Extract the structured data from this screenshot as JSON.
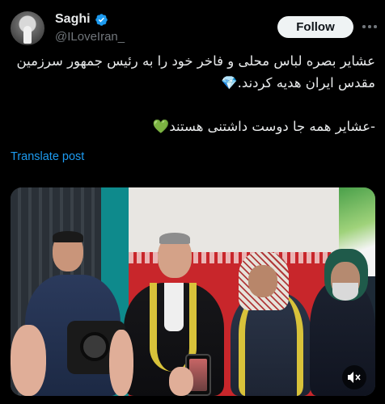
{
  "author": {
    "name": "Saghi",
    "handle": "@ILoveIran_",
    "verified_icon": "verified-badge-icon"
  },
  "actions": {
    "follow_label": "Follow",
    "more_icon": "more-options-icon"
  },
  "tweet": {
    "line1": "عشایر بصره لباس محلی و فاخر خود را به رئیس جمهور سرزمین",
    "line2": "مقدس ایران هدیه کردند.💎",
    "line3": "-عشایر همه جا دوست داشتنی هستند💚"
  },
  "translate_label": "Translate post",
  "media": {
    "type": "video",
    "mute_icon": "volume-muted-icon"
  },
  "colors": {
    "background": "#000000",
    "accent": "#1d9bf0",
    "text": "#e7e9ea",
    "muted": "#71767b"
  }
}
